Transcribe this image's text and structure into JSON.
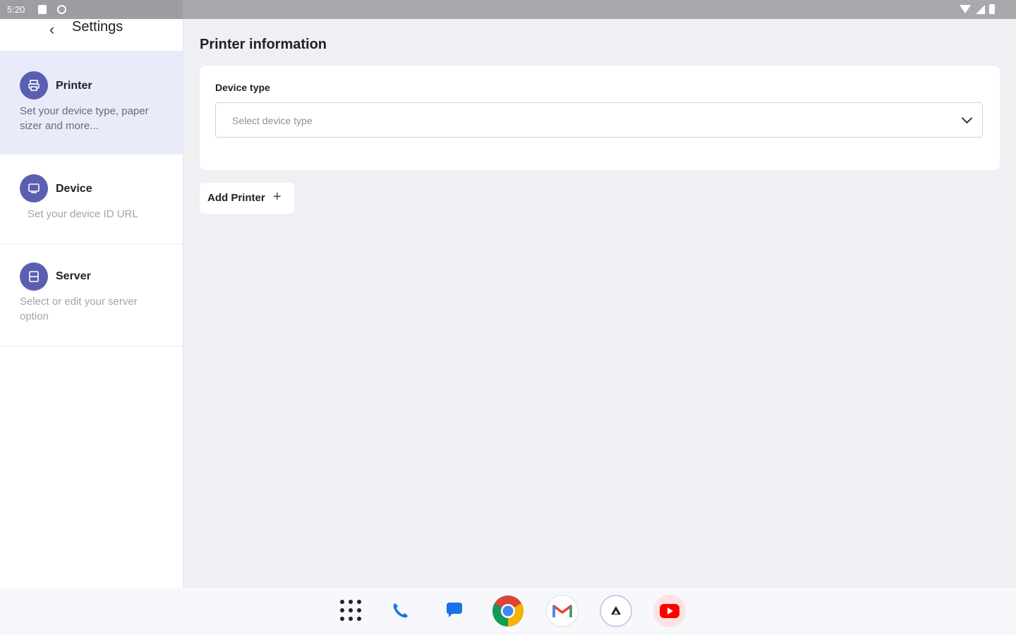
{
  "status_bar": {
    "time": "5:20"
  },
  "sidebar": {
    "title": "Settings",
    "items": [
      {
        "title": "Printer",
        "description": "Set your device type, paper sizer and more...",
        "icon": "printer-icon",
        "active": true
      },
      {
        "title": "Device",
        "description": "Set your device ID URL",
        "icon": "device-icon",
        "active": false
      },
      {
        "title": "Server",
        "description": "Select or edit your server option",
        "icon": "server-icon",
        "active": false
      }
    ]
  },
  "main": {
    "title": "Printer information",
    "device_type": {
      "label": "Device type",
      "placeholder": "Select device type"
    },
    "add_button": {
      "label": "Add Printer",
      "icon": "plus-icon"
    }
  },
  "taskbar": {
    "apps": [
      "app-drawer-icon",
      "phone-icon",
      "messages-icon",
      "chrome-icon",
      "gmail-icon",
      "drive-icon",
      "youtube-icon"
    ]
  },
  "colors": {
    "accent": "#5b5fb1",
    "active_bg": "#e9ebfb",
    "page_bg": "#eef0f4"
  }
}
